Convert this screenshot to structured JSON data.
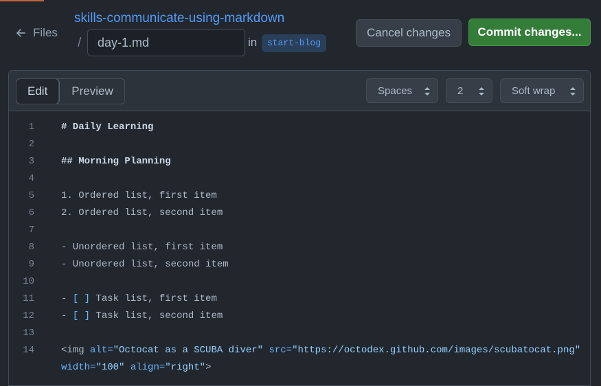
{
  "header": {
    "files_label": "Files",
    "repo_name": "skills-communicate-using-markdown",
    "slash": "/",
    "filename": "day-1.md",
    "in_label": "in",
    "branch": "start-blog",
    "cancel_label": "Cancel changes",
    "commit_label": "Commit changes..."
  },
  "editor": {
    "tabs": {
      "edit": "Edit",
      "preview": "Preview"
    },
    "indent_mode": "Spaces",
    "indent_size": "2",
    "wrap_mode": "Soft wrap"
  },
  "lines": [
    {
      "n": "1",
      "text": "# Daily Learning"
    },
    {
      "n": "2",
      "text": ""
    },
    {
      "n": "3",
      "text": "## Morning Planning"
    },
    {
      "n": "4",
      "text": ""
    },
    {
      "n": "5",
      "text": "1. Ordered list, first item"
    },
    {
      "n": "6",
      "text": "2. Ordered list, second item"
    },
    {
      "n": "7",
      "text": ""
    },
    {
      "n": "8",
      "text": "- Unordered list, first item"
    },
    {
      "n": "9",
      "text": "- Unordered list, second item"
    },
    {
      "n": "10",
      "text": ""
    },
    {
      "n": "11",
      "prefix": "- ",
      "box": "[ ]",
      "text": " Task list, first item"
    },
    {
      "n": "12",
      "prefix": "- ",
      "box": "[ ]",
      "text": " Task list, second item"
    },
    {
      "n": "13",
      "text": ""
    },
    {
      "n": "14",
      "img_open": "<img ",
      "attr_alt": "alt=",
      "val_alt": "\"Octocat as a SCUBA diver\"",
      "attr_src": "src=",
      "val_src": "\"https://octodex.github.com/images/scubatocat.png\"",
      "attr_width": "width=",
      "val_width": "\"100\"",
      "attr_align": "align=",
      "val_align": "\"right\"",
      "img_close": ">"
    }
  ],
  "colors": {
    "background": "#22272e",
    "accent_link": "#539bf5",
    "commit_green": "#347d39"
  }
}
